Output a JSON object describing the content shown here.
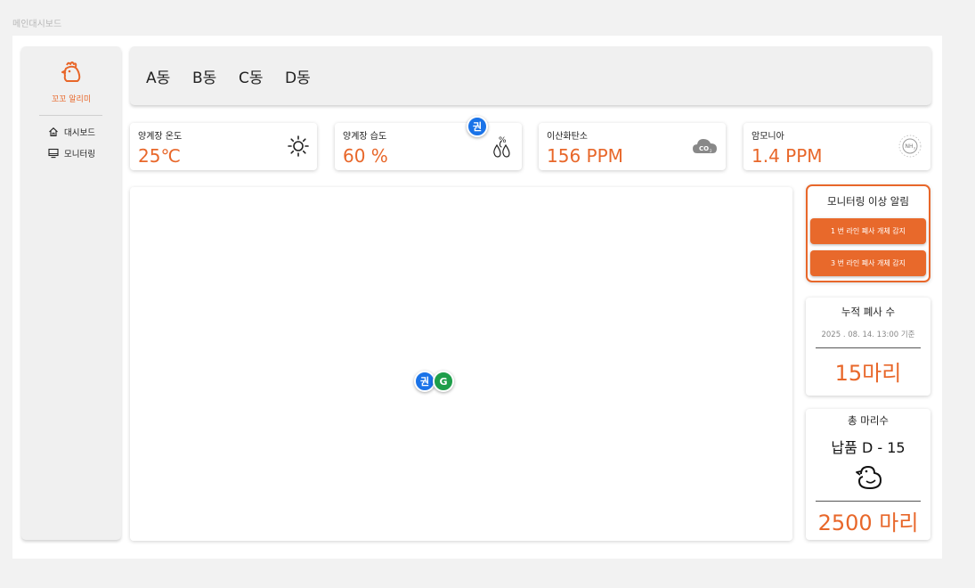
{
  "page": {
    "label": "메인대시보드"
  },
  "sidebar": {
    "brand": "꼬꼬 알리미",
    "items": [
      {
        "label": "대시보드",
        "icon": "home-icon"
      },
      {
        "label": "모니터링",
        "icon": "monitor-icon"
      }
    ]
  },
  "tabs": [
    "A동",
    "B동",
    "C동",
    "D동"
  ],
  "sensors": [
    {
      "label": "양계장 온도",
      "value": "25℃",
      "icon": "sun-icon"
    },
    {
      "label": "양계장 습도",
      "value": "60 %",
      "icon": "humidity-icon"
    },
    {
      "label": "이산화탄소",
      "value": "156 PPM",
      "icon": "co2-cloud-icon"
    },
    {
      "label": "암모니아",
      "value": "1.4 PPM",
      "icon": "nh3-icon"
    }
  ],
  "alerts": {
    "title": "모니터링 이상 알림",
    "items": [
      "1 번 라인 폐사 개체 감지",
      "3 번 라인 폐사 개체 감지"
    ]
  },
  "death_card": {
    "title": "누적 폐사 수",
    "timestamp": "2025 . 08. 14. 13:00 기준",
    "value": "15마리"
  },
  "total_card": {
    "title": "총 마리수",
    "delivery": "납품 D - 15",
    "icon": "chick-icon",
    "value": "2500 마리"
  },
  "overlays": {
    "kwon": "권",
    "g": "G"
  },
  "colors": {
    "accent": "#e8672a",
    "panel": "#f0f0f0"
  }
}
